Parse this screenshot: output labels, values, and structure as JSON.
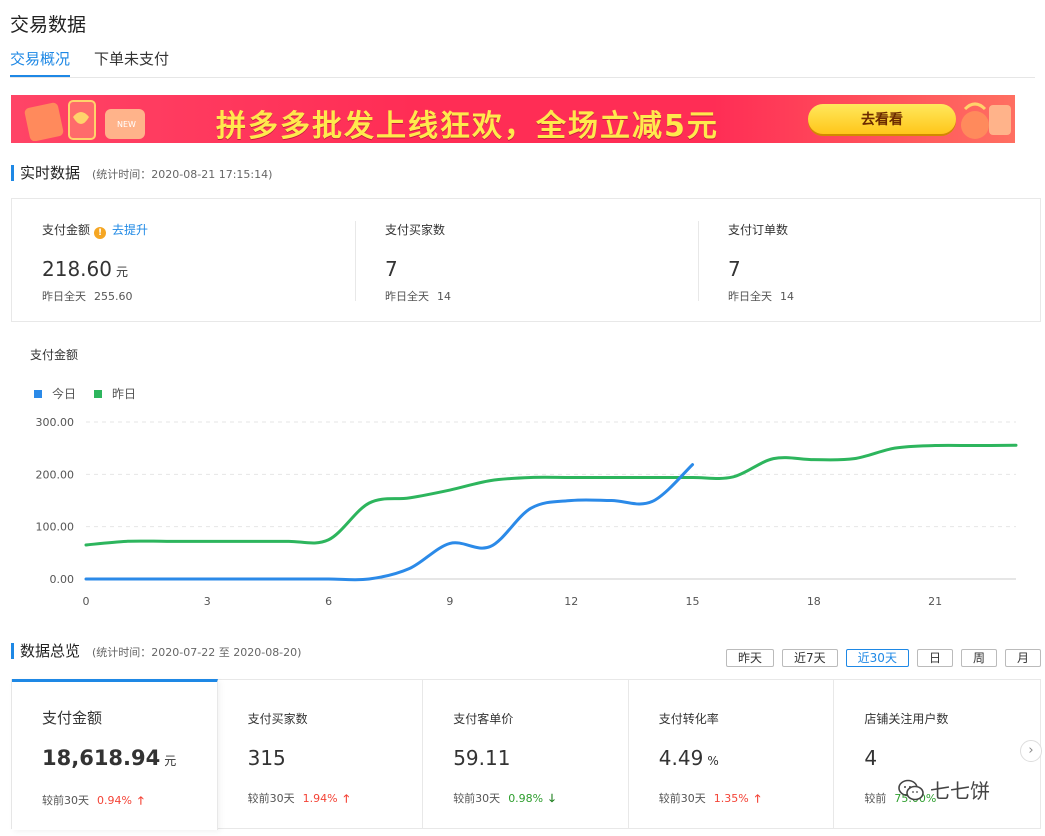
{
  "page": {
    "title": "交易数据"
  },
  "tabs": [
    {
      "label": "交易概况",
      "active": true
    },
    {
      "label": "下单未支付",
      "active": false
    }
  ],
  "banner": {
    "text": "拼多多批发上线狂欢，全场立减5元",
    "cta": "去看看"
  },
  "realtime": {
    "title": "实时数据",
    "stat_time": "(统计时间：2020-08-21 17:15:14)",
    "items": [
      {
        "label": "支付金额",
        "link": "去提升",
        "value": "218.60",
        "unit": "元",
        "yesterday_label": "昨日全天",
        "yesterday_value": "255.60"
      },
      {
        "label": "支付买家数",
        "value": "7",
        "yesterday_label": "昨日全天",
        "yesterday_value": "14"
      },
      {
        "label": "支付订单数",
        "value": "7",
        "yesterday_label": "昨日全天",
        "yesterday_value": "14"
      }
    ]
  },
  "chart": {
    "title": "支付金额",
    "legend": [
      {
        "name": "今日",
        "color": "#2b8ae8"
      },
      {
        "name": "昨日",
        "color": "#2db55d"
      }
    ]
  },
  "chart_data": {
    "type": "line",
    "title": "支付金额",
    "xlabel": "",
    "ylabel": "",
    "xlim": [
      0,
      23
    ],
    "ylim": [
      0,
      300
    ],
    "x_ticks": [
      "0",
      "3",
      "6",
      "9",
      "12",
      "15",
      "18",
      "21"
    ],
    "y_ticks": [
      "0.00",
      "100.00",
      "200.00",
      "300.00"
    ],
    "grid": true,
    "legend_position": "top-left",
    "series": [
      {
        "name": "今日",
        "color": "#2b8ae8",
        "x": [
          0,
          1,
          2,
          3,
          4,
          5,
          6,
          7,
          8,
          9,
          10,
          11,
          12,
          13,
          14,
          15
        ],
        "y": [
          0,
          0,
          0,
          0,
          0,
          0,
          0,
          0,
          20,
          68,
          62,
          135,
          150,
          150,
          148,
          218.6
        ]
      },
      {
        "name": "昨日",
        "color": "#2db55d",
        "x": [
          0,
          1,
          2,
          3,
          4,
          5,
          6,
          7,
          8,
          9,
          10,
          11,
          12,
          13,
          14,
          15,
          16,
          17,
          18,
          19,
          20,
          21,
          22,
          23
        ],
        "y": [
          65,
          72,
          72,
          72,
          72,
          72,
          75,
          145,
          155,
          170,
          188,
          194,
          194,
          194,
          194,
          194,
          195,
          230,
          228,
          230,
          250,
          255,
          255,
          255.6
        ]
      }
    ]
  },
  "overview": {
    "title": "数据总览",
    "stat_time": "(统计时间：2020-07-22 至 2020-08-20)",
    "ranges": [
      {
        "label": "昨天",
        "active": false
      },
      {
        "label": "近7天",
        "active": false
      },
      {
        "label": "近30天",
        "active": true
      },
      {
        "label": "日",
        "active": false
      },
      {
        "label": "周",
        "active": false
      },
      {
        "label": "月",
        "active": false
      }
    ],
    "cards": [
      {
        "label": "支付金额",
        "value": "18,618.94",
        "unit": "元",
        "compare_label": "较前30天",
        "pct": "0.94%",
        "trend": "up",
        "active": true
      },
      {
        "label": "支付买家数",
        "value": "315",
        "unit": "",
        "compare_label": "较前30天",
        "pct": "1.94%",
        "trend": "up",
        "active": false
      },
      {
        "label": "支付客单价",
        "value": "59.11",
        "unit": "",
        "compare_label": "较前30天",
        "pct": "0.98%",
        "trend": "down",
        "active": false
      },
      {
        "label": "支付转化率",
        "value": "4.49",
        "unit": "%",
        "compare_label": "较前30天",
        "pct": "1.35%",
        "trend": "up",
        "active": false
      },
      {
        "label": "店铺关注用户数",
        "value": "4",
        "unit": "",
        "compare_label": "较前",
        "pct": "75.00%",
        "trend": "up",
        "active": false
      }
    ]
  },
  "watermark": {
    "text": "七七饼"
  }
}
